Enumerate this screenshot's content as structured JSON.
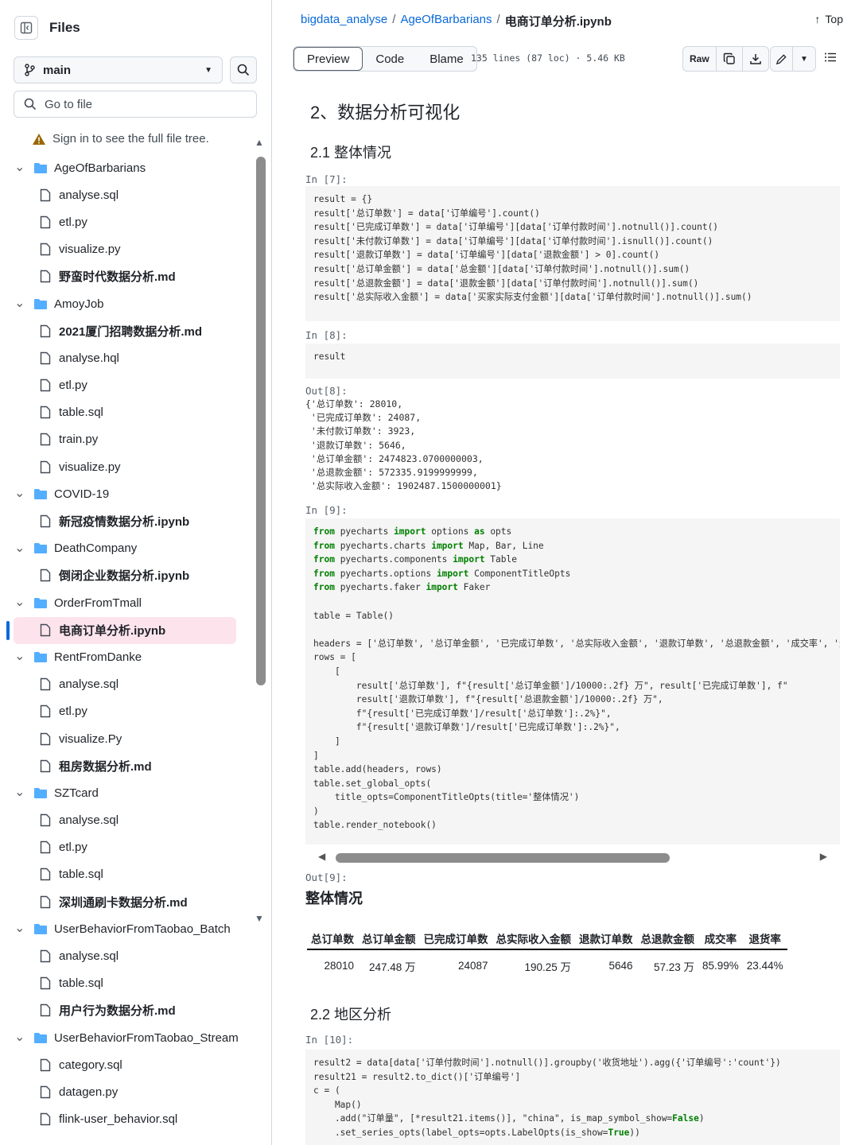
{
  "sidebar": {
    "title": "Files",
    "branch": "main",
    "goto_placeholder": "Go to file",
    "signin_notice": "Sign in to see the full file tree.",
    "tree": [
      {
        "type": "folder",
        "label": "AgeOfBarbarians"
      },
      {
        "type": "file",
        "label": "analyse.sql"
      },
      {
        "type": "file",
        "label": "etl.py"
      },
      {
        "type": "file",
        "label": "visualize.py"
      },
      {
        "type": "file",
        "label": "野蛮时代数据分析.md",
        "bold": true
      },
      {
        "type": "folder",
        "label": "AmoyJob"
      },
      {
        "type": "file",
        "label": "2021厦门招聘数据分析.md",
        "bold": true
      },
      {
        "type": "file",
        "label": "analyse.hql"
      },
      {
        "type": "file",
        "label": "etl.py"
      },
      {
        "type": "file",
        "label": "table.sql"
      },
      {
        "type": "file",
        "label": "train.py"
      },
      {
        "type": "file",
        "label": "visualize.py"
      },
      {
        "type": "folder",
        "label": "COVID-19"
      },
      {
        "type": "file",
        "label": "新冠疫情数据分析.ipynb",
        "bold": true
      },
      {
        "type": "folder",
        "label": "DeathCompany"
      },
      {
        "type": "file",
        "label": "倒闭企业数据分析.ipynb",
        "bold": true
      },
      {
        "type": "folder",
        "label": "OrderFromTmall"
      },
      {
        "type": "file",
        "label": "电商订单分析.ipynb",
        "bold": true,
        "selected": true
      },
      {
        "type": "folder",
        "label": "RentFromDanke"
      },
      {
        "type": "file",
        "label": "analyse.sql"
      },
      {
        "type": "file",
        "label": "etl.py"
      },
      {
        "type": "file",
        "label": "visualize.Py"
      },
      {
        "type": "file",
        "label": "租房数据分析.md",
        "bold": true
      },
      {
        "type": "folder",
        "label": "SZTcard"
      },
      {
        "type": "file",
        "label": "analyse.sql"
      },
      {
        "type": "file",
        "label": "etl.py"
      },
      {
        "type": "file",
        "label": "table.sql"
      },
      {
        "type": "file",
        "label": "深圳通刷卡数据分析.md",
        "bold": true
      },
      {
        "type": "folder",
        "label": "UserBehaviorFromTaobao_Batch"
      },
      {
        "type": "file",
        "label": "analyse.sql"
      },
      {
        "type": "file",
        "label": "table.sql"
      },
      {
        "type": "file",
        "label": "用户行为数据分析.md",
        "bold": true
      },
      {
        "type": "folder",
        "label": "UserBehaviorFromTaobao_Stream"
      },
      {
        "type": "file",
        "label": "category.sql"
      },
      {
        "type": "file",
        "label": "datagen.py"
      },
      {
        "type": "file",
        "label": "flink-user_behavior.sql"
      }
    ]
  },
  "header": {
    "crumb1": "bigdata_analyse",
    "crumb2": "AgeOfBarbarians",
    "crumb_current": "电商订单分析.ipynb",
    "top_label": "Top"
  },
  "toolbar": {
    "preview": "Preview",
    "code": "Code",
    "blame": "Blame",
    "file_info": "135 lines (87 loc) · 5.46 KB",
    "raw": "Raw"
  },
  "notebook": {
    "h2": "2、数据分析可视化",
    "h3_1": "2.1 整体情况",
    "p7": "In [7]:",
    "p8": "In [8]:",
    "p8_code": "result",
    "o8": "Out[8]:",
    "p9": "In [9]:",
    "o9": "Out[9]:",
    "p10": "In [10]:",
    "h3_2": "2.2 地区分析",
    "table_title": "整体情况",
    "table_headers": [
      "总订单数",
      "总订单金额",
      "已完成订单数",
      "总实际收入金额",
      "退款订单数",
      "总退款金额",
      "成交率",
      "退货率"
    ],
    "table_row": [
      "28010",
      "247.48 万",
      "24087",
      "190.25 万",
      "5646",
      "57.23 万",
      "85.99%",
      "23.44%"
    ]
  }
}
